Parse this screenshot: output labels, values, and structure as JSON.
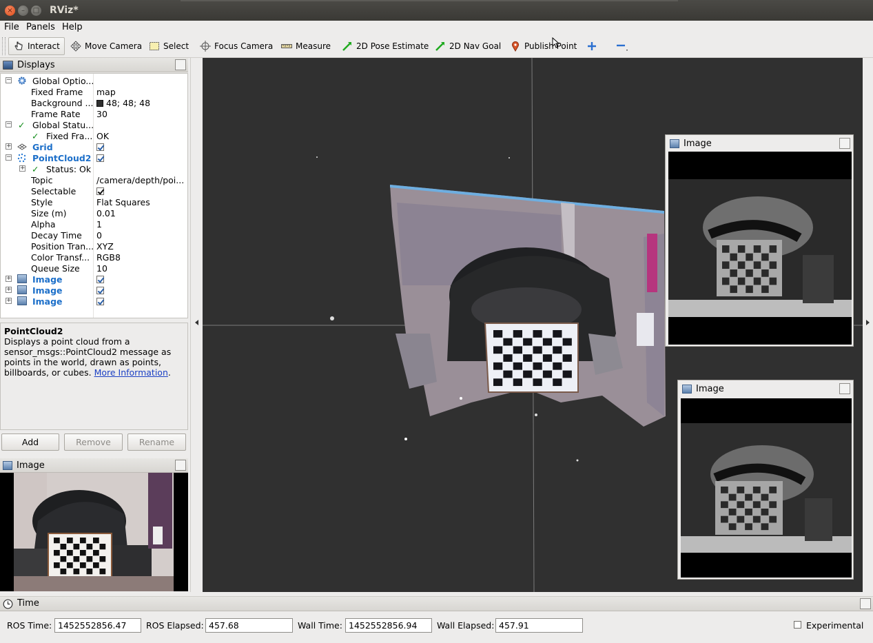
{
  "window": {
    "title": "RViz*"
  },
  "menu": [
    "File",
    "Panels",
    "Help"
  ],
  "toolbar": {
    "interact": "Interact",
    "move_camera": "Move Camera",
    "select": "Select",
    "focus_camera": "Focus Camera",
    "measure": "Measure",
    "pose_estimate": "2D Pose Estimate",
    "nav_goal": "2D Nav Goal",
    "publish_point": "Publish Point"
  },
  "displays": {
    "title": "Displays",
    "rows": {
      "global_options": "Global Optio...",
      "fixed_frame": {
        "label": "Fixed Frame",
        "value": "map"
      },
      "background": {
        "label": "Background ...",
        "value": "48; 48; 48"
      },
      "frame_rate": {
        "label": "Frame Rate",
        "value": "30"
      },
      "global_status": "Global Statu...",
      "fixed_frame_status": {
        "label": "Fixed Fra...",
        "value": "OK"
      },
      "grid": "Grid",
      "pointcloud2": "PointCloud2",
      "status_ok": "Status: Ok",
      "topic": {
        "label": "Topic",
        "value": "/camera/depth/poi..."
      },
      "selectable": {
        "label": "Selectable"
      },
      "style": {
        "label": "Style",
        "value": "Flat Squares"
      },
      "size": {
        "label": "Size (m)",
        "value": "0.01"
      },
      "alpha": {
        "label": "Alpha",
        "value": "1"
      },
      "decay": {
        "label": "Decay Time",
        "value": "0"
      },
      "position_transformer": {
        "label": "Position Tran...",
        "value": "XYZ"
      },
      "color_transformer": {
        "label": "Color Transf...",
        "value": "RGB8"
      },
      "queue_size": {
        "label": "Queue Size",
        "value": "10"
      },
      "image1": "Image",
      "image2": "Image",
      "image3": "Image"
    }
  },
  "help": {
    "title": "PointCloud2",
    "text": "Displays a point cloud from a sensor_msgs::PointCloud2 message as points in the world, drawn as points, billboards, or cubes.",
    "link": "More Information",
    "tail": "."
  },
  "buttons": {
    "add": "Add",
    "remove": "Remove",
    "rename": "Rename"
  },
  "image_panel": {
    "title": "Image"
  },
  "float_image_1": {
    "title": "Image"
  },
  "float_image_2": {
    "title": "Image"
  },
  "time": {
    "title": "Time",
    "ros_time_label": "ROS Time:",
    "ros_time": "1452552856.47",
    "ros_elapsed_label": "ROS Elapsed:",
    "ros_elapsed": "457.68",
    "wall_time_label": "Wall Time:",
    "wall_time": "1452552856.94",
    "wall_elapsed_label": "Wall Elapsed:",
    "wall_elapsed": "457.91",
    "experimental": "Experimental"
  }
}
